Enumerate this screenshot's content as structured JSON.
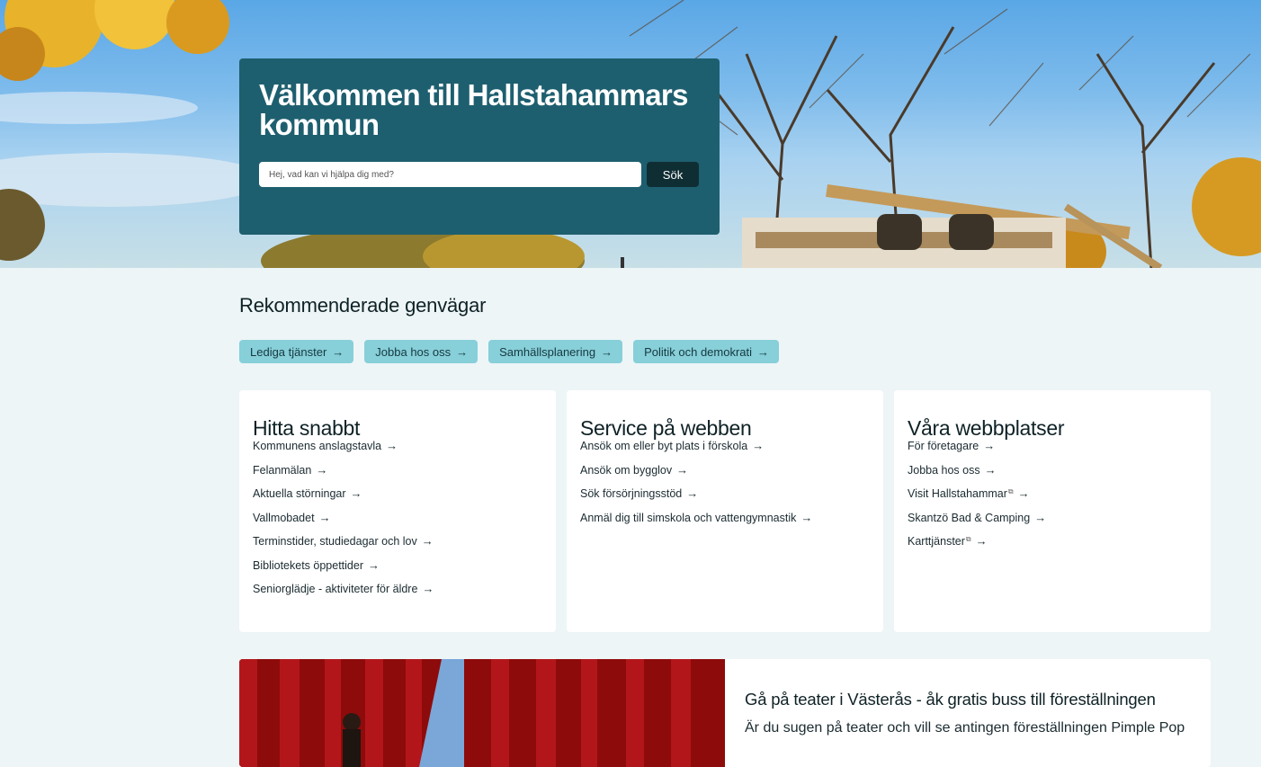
{
  "hero": {
    "title": "Välkommen till Hallstahammars kommun",
    "search_placeholder": "Hej, vad kan vi hjälpa dig med?",
    "search_button": "Sök"
  },
  "shortcuts": {
    "title": "Rekommenderade genvägar",
    "items": [
      {
        "label": "Lediga tjänster"
      },
      {
        "label": "Jobba hos oss"
      },
      {
        "label": "Samhällsplanering"
      },
      {
        "label": "Politik och demokrati"
      }
    ]
  },
  "cards": [
    {
      "title": "Hitta snabbt",
      "links": [
        {
          "label": "Kommunens anslagstavla"
        },
        {
          "label": "Felanmälan"
        },
        {
          "label": "Aktuella störningar"
        },
        {
          "label": "Vallmobadet"
        },
        {
          "label": "Terminstider, studiedagar och lov"
        },
        {
          "label": "Bibliotekets öppettider"
        },
        {
          "label": "Seniorglädje - aktiviteter för äldre"
        }
      ]
    },
    {
      "title": "Service på webben",
      "links": [
        {
          "label": "Ansök om eller byt plats i förskola"
        },
        {
          "label": "Ansök om bygglov"
        },
        {
          "label": "Sök försörjningsstöd"
        },
        {
          "label": "Anmäl dig till simskola och vattengymnastik"
        }
      ]
    },
    {
      "title": "Våra webbplatser",
      "links": [
        {
          "label": "För företagare"
        },
        {
          "label": "Jobba hos oss"
        },
        {
          "label": "Visit Hallstahammar",
          "external": true
        },
        {
          "label": "Skantzö Bad & Camping"
        },
        {
          "label": "Karttjänster",
          "external": true
        }
      ]
    }
  ],
  "news": {
    "title": "Gå på teater i Västerås - åk gratis buss till föreställningen",
    "text": "Är du sugen på teater och vill se antingen föreställningen Pimple Pop"
  },
  "icons": {
    "arrow": "arrow-right-icon",
    "external": "external-link-icon"
  },
  "colors": {
    "welcome_box": "#1e5f6f",
    "chip": "#87cfd9",
    "search_button": "#0f2e33",
    "page_bg": "#edf5f7"
  }
}
